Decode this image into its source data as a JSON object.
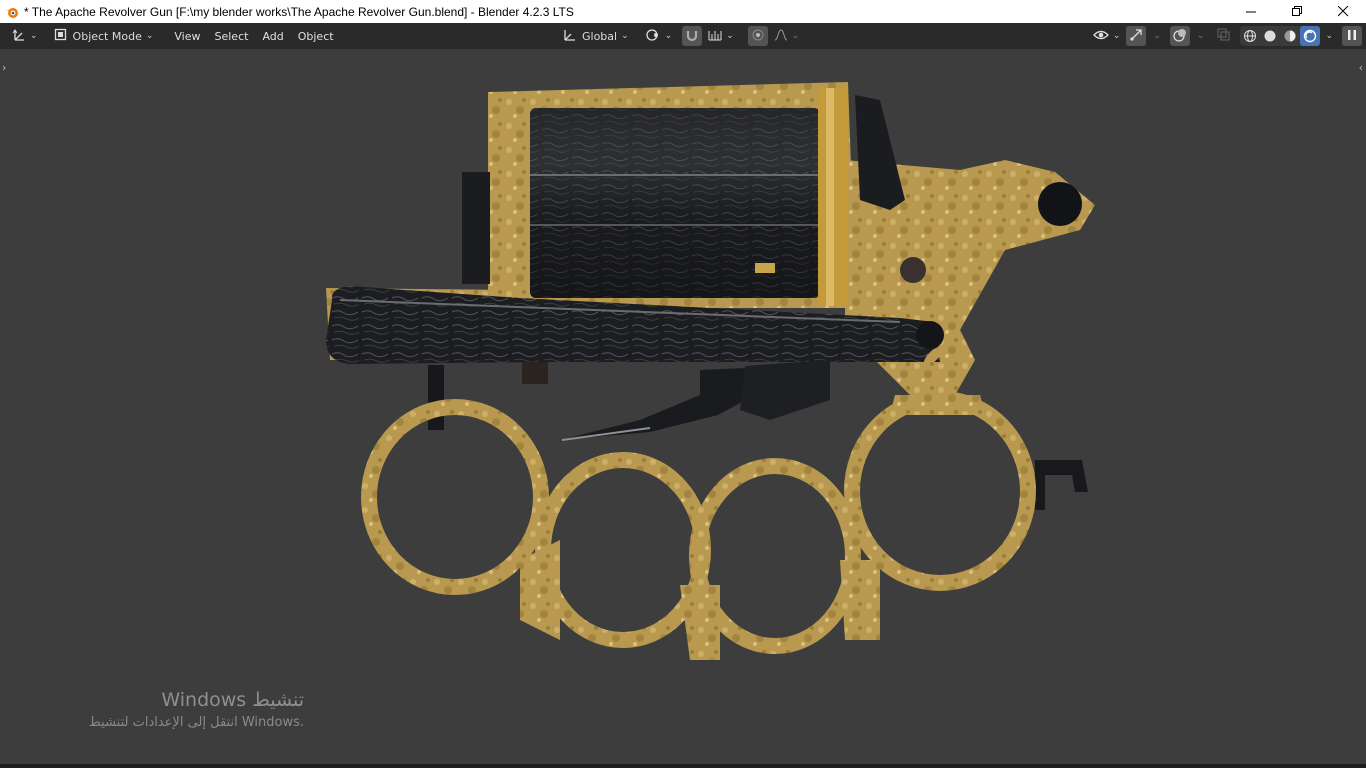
{
  "window": {
    "title": "* The Apache Revolver Gun [F:\\my blender works\\The Apache Revolver Gun.blend] - Blender 4.2.3 LTS",
    "controls": [
      "minimize-icon",
      "restore-icon",
      "close-icon"
    ]
  },
  "header": {
    "editor_type_icon": "axes-icon",
    "mode_label": "Object Mode",
    "menus": [
      "View",
      "Select",
      "Add",
      "Object"
    ],
    "transform_orientation": "Global",
    "pivot_icon": "pivot-icon",
    "snap_icon": "magnet-icon",
    "snap_target_icon": "snap-increment-icon",
    "proportional_icon": "proportional-edit-icon",
    "falloff_icon": "falloff-curve-icon",
    "visibility_icon": "eye-icon",
    "gizmo_icon": "gizmo-icon",
    "overlay_icon": "overlay-icon",
    "xray_icon": "xray-icon",
    "shading_modes": [
      "wireframe-icon",
      "solid-icon",
      "material-preview-icon",
      "rendered-icon"
    ],
    "active_shading": "rendered-icon",
    "sidebar_toggle_icon": "pause-icon"
  },
  "watermark": {
    "title": "Windows تنشيط",
    "subtitle": "انتقل إلى الإعدادات لتنشيط Windows."
  },
  "colors": {
    "viewport_bg": "#3d3d3d",
    "header_bg": "#2a2a2a",
    "accent": "#4772b3",
    "brass": "#b8994f",
    "steel": "#1e1f22"
  }
}
